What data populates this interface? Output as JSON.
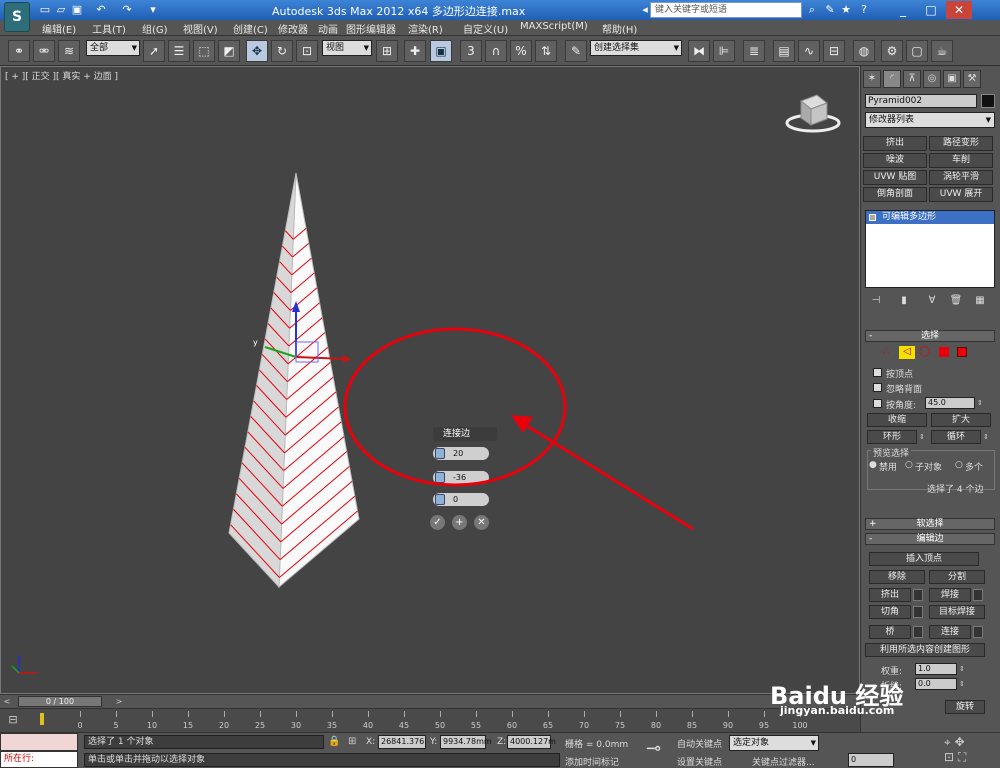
{
  "titlebar": {
    "title": "Autodesk 3ds Max  2012 x64      多边形边连接.max",
    "search_placeholder": "键入关键字或短语"
  },
  "menu": [
    "编辑(E)",
    "工具(T)",
    "组(G)",
    "视图(V)",
    "创建(C)",
    "修改器",
    "动画",
    "图形编辑器",
    "渲染(R)",
    "自定义(U)",
    "MAXScript(M)",
    "帮助(H)"
  ],
  "toolbar": {
    "selection_filter": "全部",
    "reference_coord": "视图",
    "named_selection": "创建选择集",
    "snap_angle_label": "3",
    "percent_snap_label": "%"
  },
  "viewport": {
    "label": "[ + ][ 正交 ][ 真实 + 边面 ]",
    "gizmo_axes": {
      "x": "x",
      "y": "y",
      "z": "z"
    },
    "caddy": {
      "title": "连接边",
      "segments": "20",
      "pinch": "-36",
      "slide": "0"
    }
  },
  "command_panel": {
    "object_name": "Pyramid002",
    "object_color": "#111111",
    "modifier_list": "修改器列表",
    "modifier_buttons": [
      "挤出",
      "路径变形",
      "噪波",
      "车削",
      "UVW 贴图",
      "涡轮平滑",
      "倒角剖面",
      "UVW 展开"
    ],
    "stack_item": "可编辑多边形",
    "selection": {
      "title": "选择",
      "by_vertex": "按顶点",
      "ignore_backfacing": "忽略背面",
      "by_angle": "按角度:",
      "angle_value": "45.0",
      "shrink": "收缩",
      "grow": "扩大",
      "ring": "环形",
      "loop": "循环",
      "preview_title": "预览选择",
      "preview_off": "禁用",
      "preview_subobj": "子对象",
      "preview_multi": "多个",
      "selected_info": "选择了 4 个边"
    },
    "soft_selection": "软选择",
    "edit_edges": {
      "title": "编辑边",
      "insert_vertex": "插入顶点",
      "remove": "移除",
      "split": "分割",
      "extrude": "挤出",
      "weld": "焊接",
      "chamfer": "切角",
      "target_weld": "目标焊接",
      "bridge": "桥",
      "connect": "连接",
      "create_shape": "利用所选内容创建图形",
      "weight_label": "权重:",
      "weight_value": "1.0",
      "crease_label": "折缝:",
      "crease_value": "0.0",
      "rotate": "旋转"
    }
  },
  "timeline": {
    "frame_display": "0 / 100",
    "ticks": [
      "0",
      "5",
      "10",
      "15",
      "20",
      "25",
      "30",
      "35",
      "40",
      "45",
      "50",
      "55",
      "60",
      "65",
      "70",
      "75",
      "80",
      "85",
      "90",
      "95",
      "100"
    ]
  },
  "status": {
    "maxscript_label": "所在行:",
    "selected": "选择了 1 个对象",
    "prompt": "单击或单击并拖动以选择对象",
    "x_label": "X:",
    "x_value": "26841.376",
    "y_label": "Y:",
    "y_value": "9934.78mm",
    "z_label": "Z:",
    "z_value": "4000.127m",
    "grid": "栅格 = 0.0mm",
    "add_time_tag": "添加时间标记",
    "auto_key": "自动关键点",
    "set_key": "设置关键点",
    "selected_object": "选定对象",
    "key_filters": "关键点过滤器...",
    "current_frame": "0"
  },
  "watermark": {
    "brand": "Baidu 经验",
    "url": "jingyan.baidu.com"
  },
  "colors": {
    "annotation_red": "#e8000b",
    "stack_highlight": "#3b70c4",
    "viewport_bg": "#444444"
  }
}
